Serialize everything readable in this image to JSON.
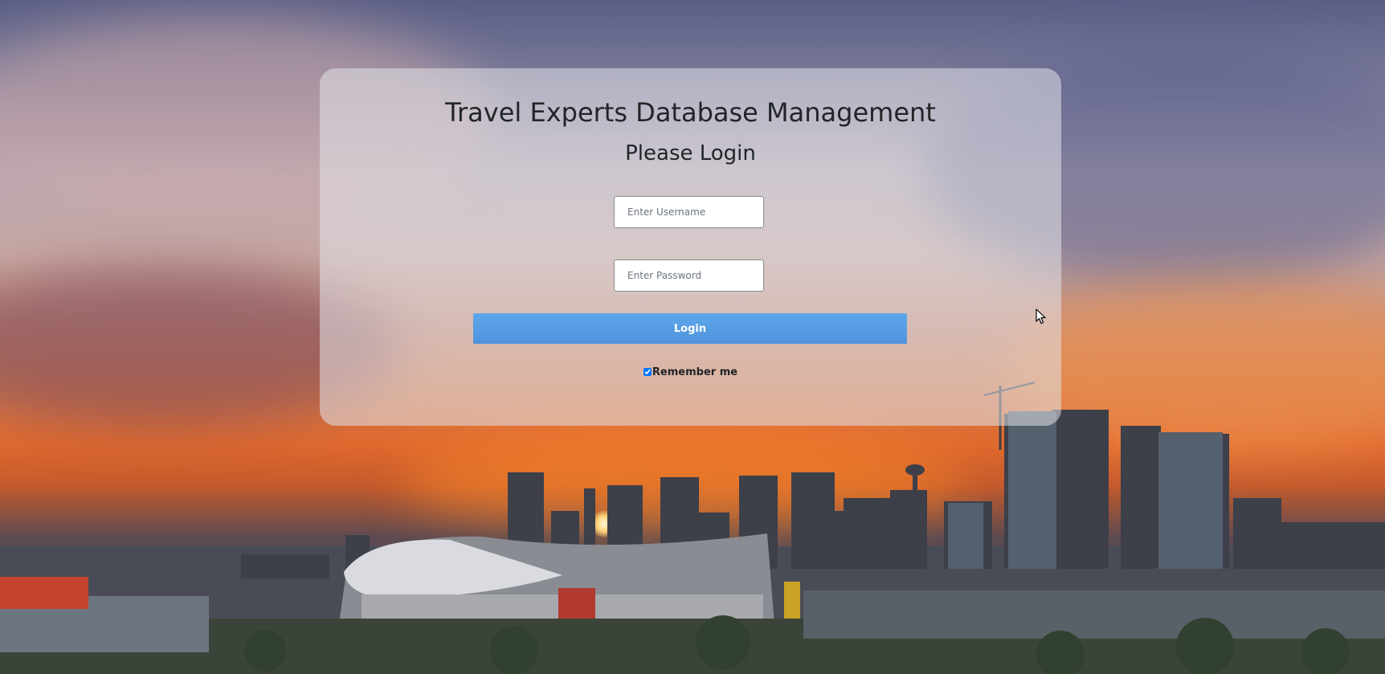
{
  "panel": {
    "title": "Travel Experts Database Management",
    "subtitle": "Please Login"
  },
  "form": {
    "username_placeholder": "Enter Username",
    "username_value": "",
    "password_placeholder": "Enter Password",
    "password_value": "",
    "login_label": "Login",
    "remember_label": "Remember me",
    "remember_checked": true
  },
  "colors": {
    "login_button": "#5a9ee6",
    "panel_text": "#212529"
  },
  "icons": {
    "cursor": "mouse-pointer-icon"
  }
}
